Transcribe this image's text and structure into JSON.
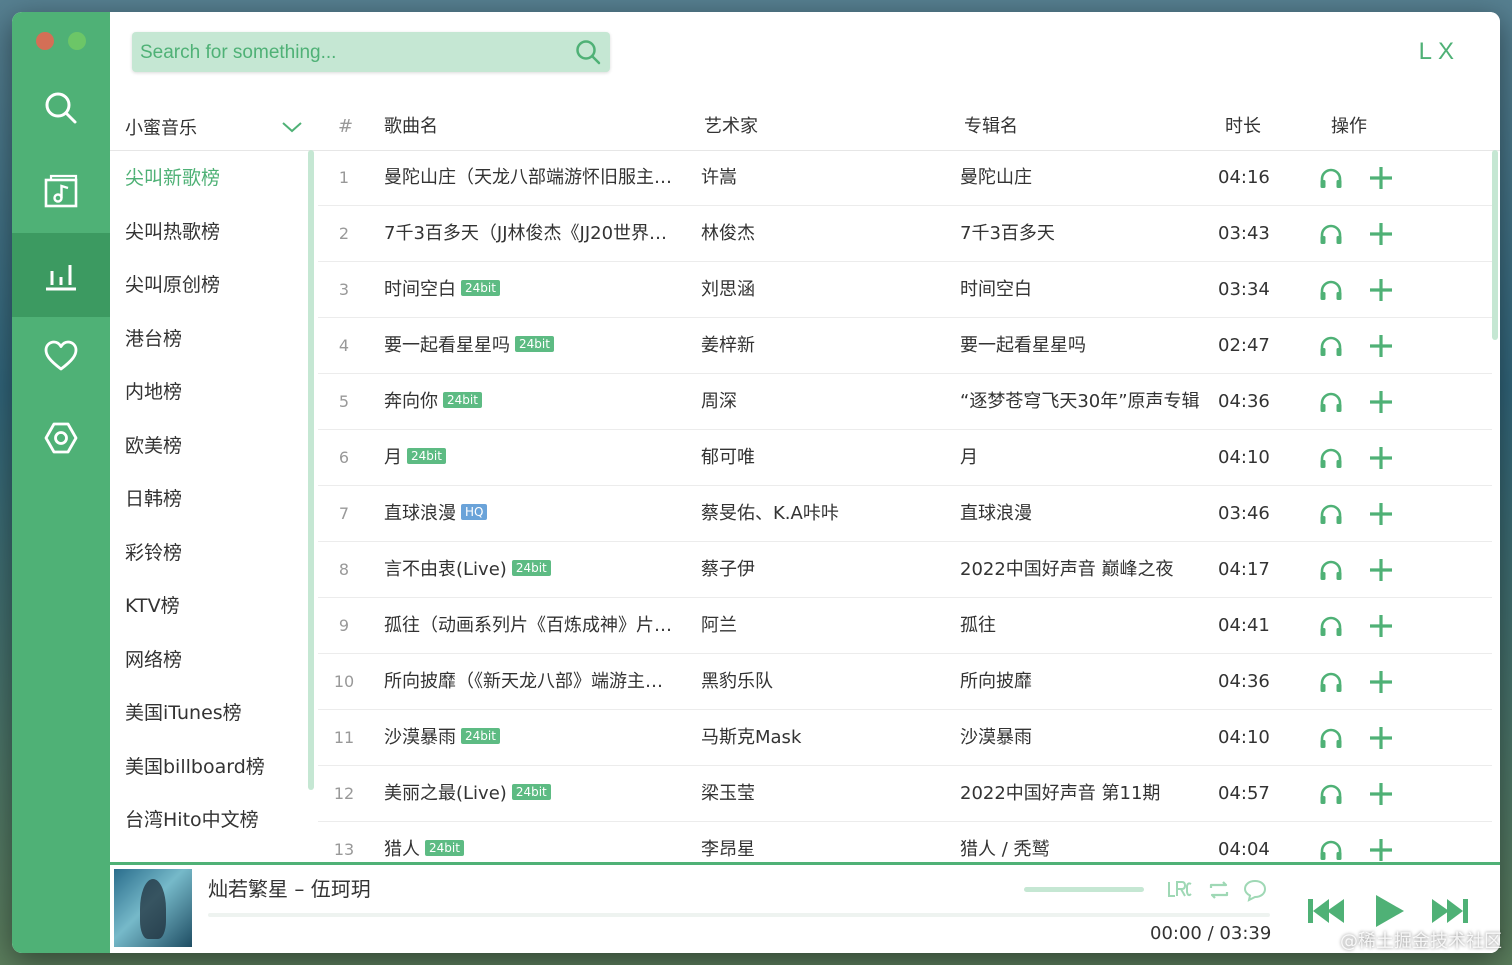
{
  "search": {
    "placeholder": "Search for something..."
  },
  "brand": "LX",
  "source": {
    "selected": "小蜜音乐"
  },
  "columns": {
    "num": "#",
    "name": "歌曲名",
    "artist": "艺术家",
    "album": "专辑名",
    "duration": "时长",
    "ops": "操作"
  },
  "boards": [
    "尖叫新歌榜",
    "尖叫热歌榜",
    "尖叫原创榜",
    "港台榜",
    "内地榜",
    "欧美榜",
    "日韩榜",
    "彩铃榜",
    "KTV榜",
    "网络榜",
    "美国iTunes榜",
    "美国billboard榜",
    "台湾Hito中文榜"
  ],
  "songs": [
    {
      "num": "1",
      "name": "曼陀山庄（天龙八部端游怀旧服主…",
      "tag": "",
      "artist": "许嵩",
      "album": "曼陀山庄",
      "duration": "04:16"
    },
    {
      "num": "2",
      "name": "7千3百多天（JJ林俊杰《JJ20世界…",
      "tag": "",
      "artist": "林俊杰",
      "album": "7千3百多天",
      "duration": "03:43"
    },
    {
      "num": "3",
      "name": "时间空白",
      "tag": "24bit",
      "artist": "刘思涵",
      "album": "时间空白",
      "duration": "03:34"
    },
    {
      "num": "4",
      "name": "要一起看星星吗",
      "tag": "24bit",
      "artist": "姜梓新",
      "album": "要一起看星星吗",
      "duration": "02:47"
    },
    {
      "num": "5",
      "name": "奔向你",
      "tag": "24bit",
      "artist": "周深",
      "album": "“逐梦苍穹飞天30年”原声专辑",
      "duration": "04:36"
    },
    {
      "num": "6",
      "name": "月",
      "tag": "24bit",
      "artist": "郁可唯",
      "album": "月",
      "duration": "04:10"
    },
    {
      "num": "7",
      "name": "直球浪漫",
      "tag": "HQ",
      "artist": "蔡旻佑、K.A咔咔",
      "album": "直球浪漫",
      "duration": "03:46"
    },
    {
      "num": "8",
      "name": "言不由衷(Live)",
      "tag": "24bit",
      "artist": "蔡子伊",
      "album": "2022中国好声音 巅峰之夜",
      "duration": "04:17"
    },
    {
      "num": "9",
      "name": "孤往（动画系列片《百炼成神》片…",
      "tag": "",
      "artist": "阿兰",
      "album": "孤往",
      "duration": "04:41"
    },
    {
      "num": "10",
      "name": "所向披靡（《新天龙八部》端游主…",
      "tag": "",
      "artist": "黑豹乐队",
      "album": "所向披靡",
      "duration": "04:36"
    },
    {
      "num": "11",
      "name": "沙漠暴雨",
      "tag": "24bit",
      "artist": "马斯克Mask",
      "album": "沙漠暴雨",
      "duration": "04:10"
    },
    {
      "num": "12",
      "name": "美丽之最(Live)",
      "tag": "24bit",
      "artist": "梁玉莹",
      "album": "2022中国好声音 第11期",
      "duration": "04:57"
    },
    {
      "num": "13",
      "name": "猎人",
      "tag": "24bit",
      "artist": "李昂星",
      "album": "猎人 / 秃鹫",
      "duration": "04:04"
    }
  ],
  "player": {
    "title": "灿若繁星 – 伍珂玥",
    "current_time": "00:00",
    "separator": "/",
    "total_time": "03:39",
    "progress": 0.0
  },
  "watermark": "@稀土掘金技术社区",
  "colors": {
    "accent": "#4fb176",
    "accent_dark": "#3c9a61",
    "accent_light": "#c5e7d3"
  }
}
